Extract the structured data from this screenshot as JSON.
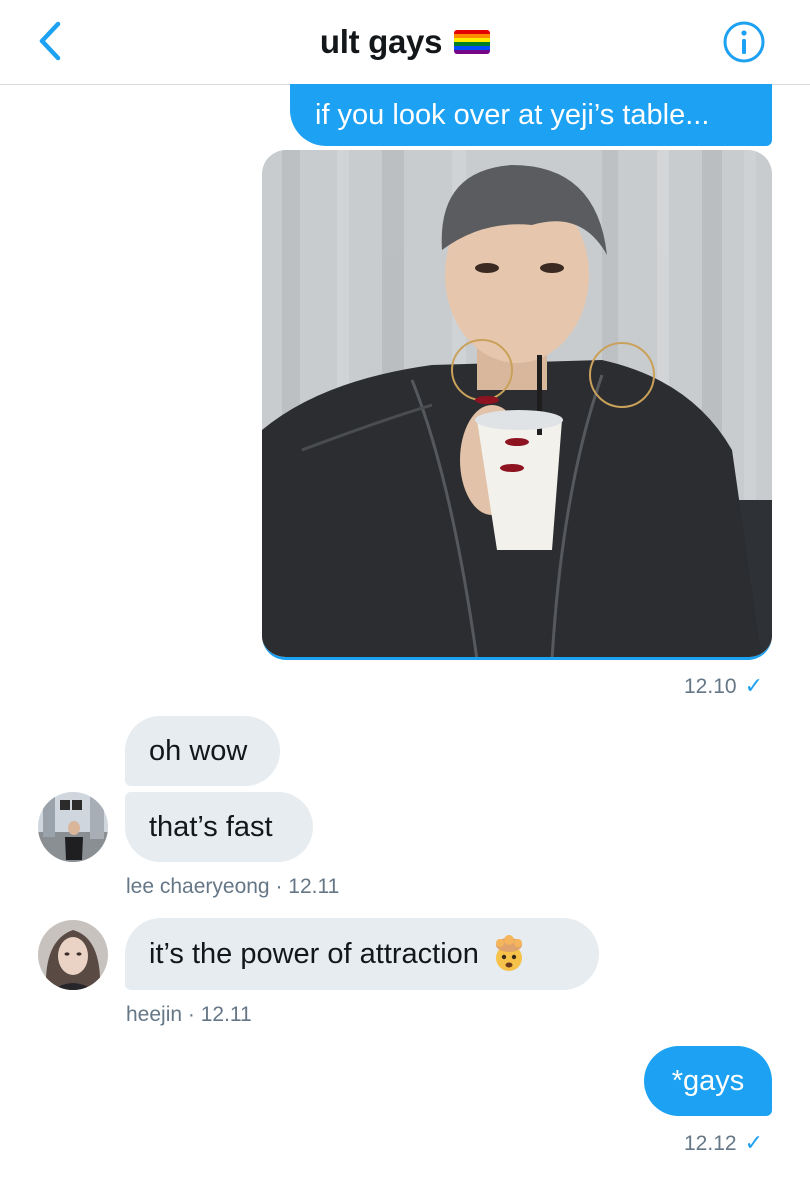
{
  "header": {
    "title": "ult gays",
    "flag_colors": [
      "#e40303",
      "#ff8c00",
      "#ffed00",
      "#008026",
      "#004dff",
      "#750787"
    ],
    "back_icon": "chevron-left-icon",
    "info_icon": "info-circle-icon",
    "accent": "#1da1f2"
  },
  "messages": [
    {
      "id": "m1",
      "direction": "outgoing",
      "text": "if you look over at yeji’s table..."
    },
    {
      "id": "m2",
      "direction": "outgoing",
      "type": "photo",
      "time": "12.10",
      "status_icon": "checkmark-icon"
    },
    {
      "id": "m3",
      "direction": "incoming",
      "text": "oh wow"
    },
    {
      "id": "m4",
      "direction": "incoming",
      "text": "that’s fast",
      "sender": "lee chaeryeong",
      "time": "12.11",
      "sender_line": "lee chaeryeong · 12.11"
    },
    {
      "id": "m5",
      "direction": "incoming",
      "text": "it’s the power of attraction",
      "emoji_icon": "exploding-head-emoji",
      "sender": "heejin",
      "time": "12.11",
      "sender_line": "heejin · 12.11"
    },
    {
      "id": "m6",
      "direction": "outgoing",
      "text": "*gays",
      "time": "12.12",
      "status_icon": "checkmark-icon"
    }
  ],
  "colors": {
    "outgoing_bubble": "#1da1f2",
    "incoming_bubble": "#e6ecf0",
    "meta_text": "#657786"
  }
}
